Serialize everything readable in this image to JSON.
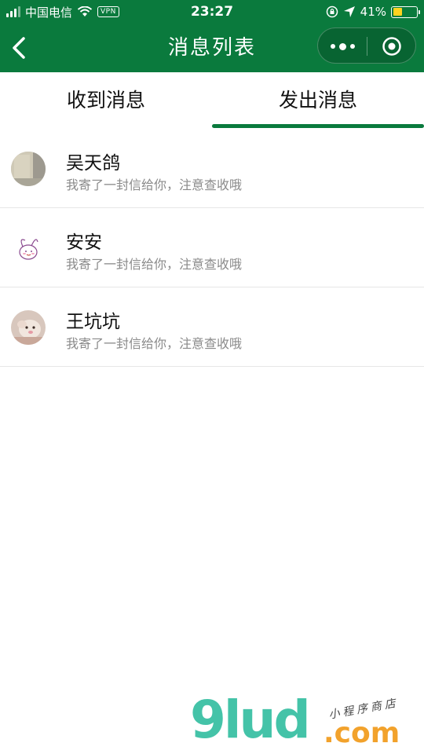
{
  "status_bar": {
    "carrier": "中国电信",
    "vpn": "VPN",
    "time": "23:27",
    "battery": "41%",
    "battery_level": 0.41,
    "battery_color": "#ffd21f"
  },
  "nav": {
    "title": "消息列表",
    "bg_color": "#0a7a3d"
  },
  "tabs": [
    {
      "label": "收到消息",
      "active": false
    },
    {
      "label": "发出消息",
      "active": true
    }
  ],
  "messages": [
    {
      "name": "吴天鸽",
      "preview": "我寄了一封信给你，注意查收哦"
    },
    {
      "name": "安安",
      "preview": "我寄了一封信给你，注意查收哦"
    },
    {
      "name": "王坑坑",
      "preview": "我寄了一封信给你，注意查收哦"
    }
  ],
  "watermark": {
    "logo": "9lud",
    "domain": ".com",
    "tagline": "小程序商店"
  }
}
